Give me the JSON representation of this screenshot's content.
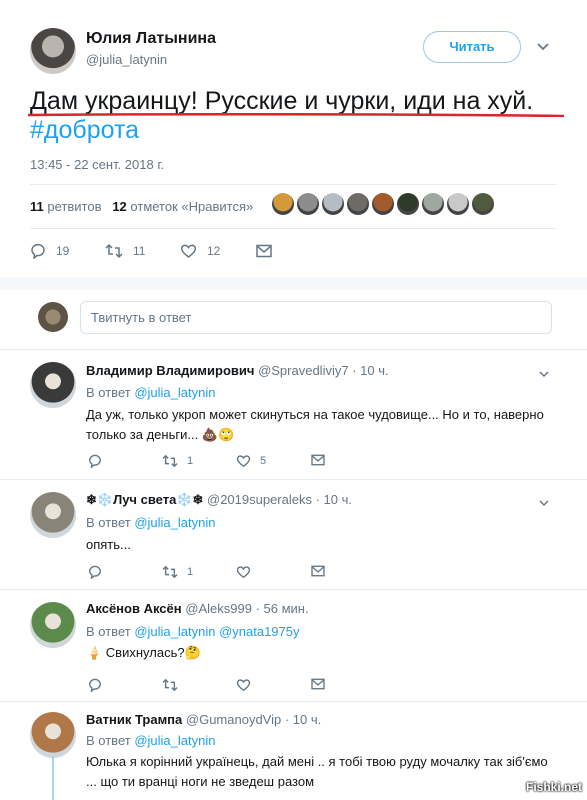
{
  "author": {
    "name": "Юлия Латынина",
    "handle": "@julia_latynin",
    "follow_label": "Читать"
  },
  "tweet": {
    "text": "Дам украинцу! Русские и чурки, иди на хуй.",
    "hashtag": "#доброта",
    "timestamp": "13:45 - 22 сент. 2018 г.",
    "retweets_count": "11",
    "retweets_label": "ретвитов",
    "likes_count": "12",
    "likes_label": "отметок «Нравится»",
    "actions": {
      "replies": "19",
      "retweets": "11",
      "likes": "12"
    },
    "liker_colors": [
      "#d49a3a",
      "#8c8c8c",
      "#b5bcc3",
      "#6e6a66",
      "#a35b2e",
      "#2e3b2a",
      "#9fa8a0",
      "#c9c9c9",
      "#4f5a3e"
    ]
  },
  "reply_box": {
    "placeholder": "Твитнуть в ответ"
  },
  "replies": [
    {
      "name": "Владимир Владимирович",
      "handle": "@Spravedliviy7",
      "time": "· 10 ч.",
      "in_reply_prefix": "В ответ",
      "in_reply_to": "@julia_latynin",
      "text": "Да уж, только укроп может скинуться на такое чудовище... Но и то, наверно только за деньги... 💩🙄",
      "counts": {
        "replies": "",
        "retweets": "1",
        "likes": "5"
      },
      "avatar_color": "#3a3a3a"
    },
    {
      "name": "❄❄️Луч света❄️❄",
      "handle": "@2019superaleks",
      "time": "· 10 ч.",
      "in_reply_prefix": "В ответ",
      "in_reply_to": "@julia_latynin",
      "text": "опять...",
      "counts": {
        "replies": "",
        "retweets": "1",
        "likes": ""
      },
      "avatar_color": "#8a8478"
    },
    {
      "name": "Аксёнов Аксён",
      "handle": "@Aleks999",
      "time": "· 56 мин.",
      "in_reply_prefix": "В ответ",
      "in_reply_to": "@julia_latynin @ynata1975y",
      "text": "🍦 Свихнулась?🤔",
      "counts": {
        "replies": "",
        "retweets": "",
        "likes": ""
      },
      "avatar_color": "#5b8a4a"
    },
    {
      "name": "Ватник Трампа",
      "handle": "@GumanoydVip",
      "time": "· 10 ч.",
      "in_reply_prefix": "В ответ",
      "in_reply_to": "@julia_latynin",
      "text": "Юлька я корінний українець, дай мені .. я тобі твою руду мочалку так зіб'ємо ... що ти вранці ноги не зведеш разом",
      "avatar_color": "#b07848"
    }
  ],
  "watermark": "Fishki.net"
}
